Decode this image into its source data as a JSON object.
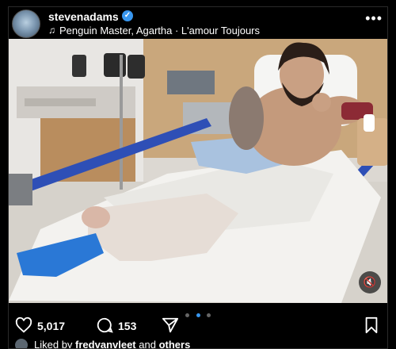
{
  "post": {
    "username": "stevenadams",
    "verified_mark": "✓",
    "music_icon": "♫",
    "audio": "Penguin Master, Agartha · L'amour Toujours",
    "more": "•••"
  },
  "media": {
    "description_icon": "hospital-photo",
    "mute_icon": "🔇"
  },
  "carousel": {
    "count": 3,
    "active_index": 1
  },
  "actions": {
    "likes": "5,017",
    "comments": "153"
  },
  "liked_by": {
    "prefix": "Liked by ",
    "user": "fredvanvleet",
    "joiner": " and ",
    "others": "others"
  },
  "colors": {
    "verified": "#3897f0",
    "active_dot": "#3897f0",
    "background": "#000000"
  }
}
